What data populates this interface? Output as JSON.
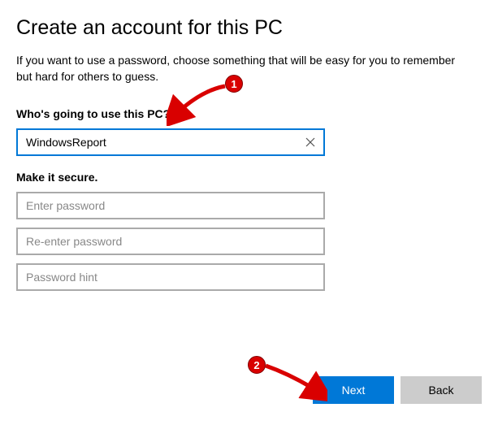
{
  "title": "Create an account for this PC",
  "intro": "If you want to use a password, choose something that will be easy for you to remember but hard for others to guess.",
  "username_label": "Who's going to use this PC?",
  "username_value": "WindowsReport",
  "secure_label": "Make it secure.",
  "password_placeholder": "Enter password",
  "password2_placeholder": "Re-enter password",
  "hint_placeholder": "Password hint",
  "next_label": "Next",
  "back_label": "Back",
  "annotations": {
    "a1": "1",
    "a2": "2"
  }
}
